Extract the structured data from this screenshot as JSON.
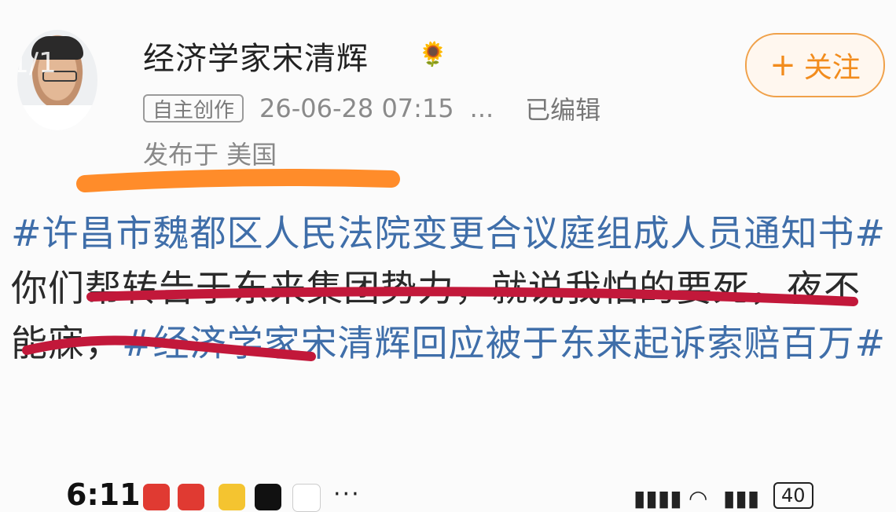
{
  "post": {
    "page_indicator": "1/1",
    "author": "经济学家宋清辉",
    "author_badge_icon": "sunflower-icon",
    "follow_label": "关注",
    "follow_plus": "+",
    "badge": "自主创作",
    "timestamp": "26-06-28 07:15",
    "ellipsis": "...",
    "edited": "已编辑",
    "location": "发布于 美国",
    "body": {
      "hashtag1": "#许昌市魏都区人民法院变更合议庭组成人员通知书#",
      "text": "你们帮转告于东来集团势力，就说我怕的要死，夜不能寐，",
      "hashtag2": "#经济学家宋清辉回应被于东来起诉索赔百万#"
    }
  },
  "status_bar": {
    "time": "6:11",
    "more": "···",
    "battery": "40"
  },
  "colors": {
    "hashtag": "#3f6ea9",
    "follow_accent": "#f28c1d",
    "underline_orange": "#ff8c2a",
    "strike_red": "#c2183a"
  }
}
